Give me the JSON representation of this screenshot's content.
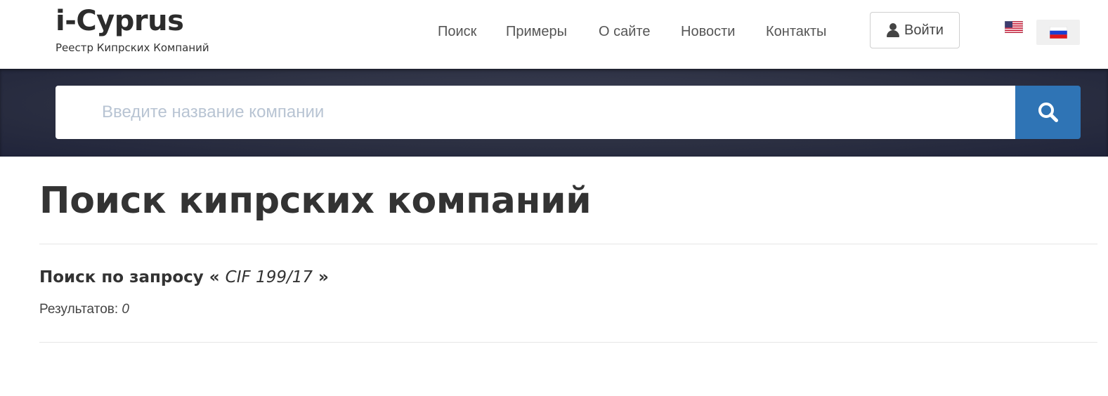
{
  "brand": {
    "title": "i-Cyprus",
    "subtitle": "Реестр Кипрских Компаний"
  },
  "nav": {
    "items": [
      {
        "label": "Поиск"
      },
      {
        "label": "Примеры"
      },
      {
        "label": "О сайте"
      },
      {
        "label": "Новости"
      },
      {
        "label": "Контакты"
      }
    ],
    "login_label": "Войти"
  },
  "languages": [
    {
      "icon": "us-flag-icon",
      "selected": false
    },
    {
      "icon": "ru-flag-icon",
      "selected": true
    }
  ],
  "search": {
    "placeholder": "Введите название компании",
    "value": "",
    "button_icon": "search-icon"
  },
  "main": {
    "title": "Поиск кипрских компаний",
    "query_prefix": "Поиск по запросу «",
    "query_value": "CIF 199/17",
    "query_suffix": "»",
    "results_label": "Результатов:",
    "results_count": "0"
  },
  "colors": {
    "accent": "#2f74b5",
    "hero_bg": "#2c3042",
    "placeholder": "#b8c4d3",
    "text": "#333333"
  }
}
